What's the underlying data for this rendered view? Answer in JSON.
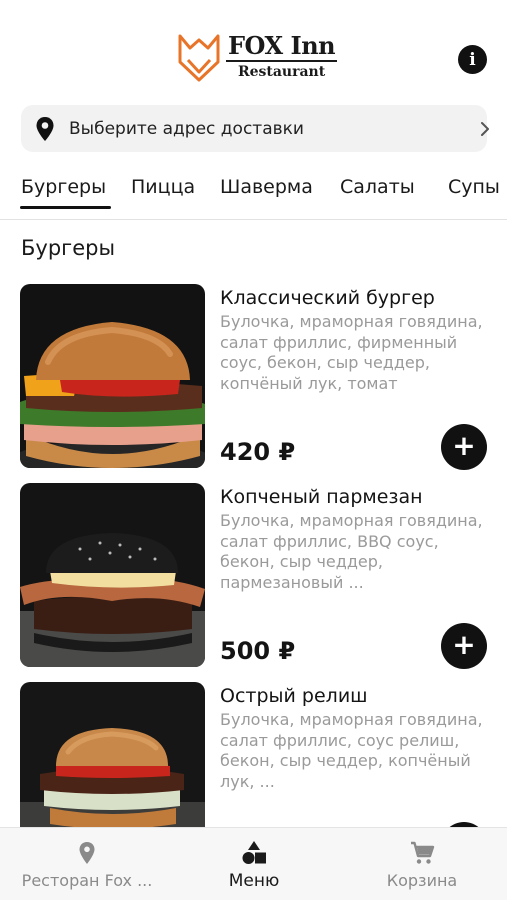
{
  "header": {
    "logo_title": "FOX Inn",
    "logo_subtitle": "Restaurant",
    "info_icon": "info-icon"
  },
  "address": {
    "placeholder": "Выберите адрес доставки",
    "icon": "location-pin-icon"
  },
  "tabs": [
    {
      "label": "Бургеры",
      "active": true
    },
    {
      "label": "Пицца",
      "active": false
    },
    {
      "label": "Шаверма",
      "active": false
    },
    {
      "label": "Салаты",
      "active": false
    },
    {
      "label": "Супы",
      "active": false
    }
  ],
  "section": {
    "title": "Бургеры"
  },
  "products": [
    {
      "name": "Классический бургер",
      "description": "Булочка, мраморная говядина, салат фриллис, фирменный соус, бекон, сыр чеддер, копчёный лук, томат",
      "price": "420 ₽",
      "bun": "classic"
    },
    {
      "name": "Копченый пармезан",
      "description": "Булочка, мраморная говядина, салат фриллис, BBQ соус, бекон, сыр чеддер, пармезановый ...",
      "price": "500 ₽",
      "bun": "black"
    },
    {
      "name": "Острый релиш",
      "description": "Булочка, мраморная говядина, салат фриллис, соус релиш, бекон, сыр чеддер, копчёный лук, ...",
      "price": "",
      "bun": "classic"
    }
  ],
  "bottom_nav": [
    {
      "label": "Ресторан Fox ...",
      "icon": "location-pin-icon",
      "active": false
    },
    {
      "label": "Меню",
      "icon": "shapes-icon",
      "active": true
    },
    {
      "label": "Корзина",
      "icon": "cart-icon",
      "active": false
    }
  ],
  "colors": {
    "accent": "#111111",
    "logo_orange": "#e8742a",
    "muted_text": "#9a9a9a",
    "address_bg": "#f2f2f2"
  }
}
